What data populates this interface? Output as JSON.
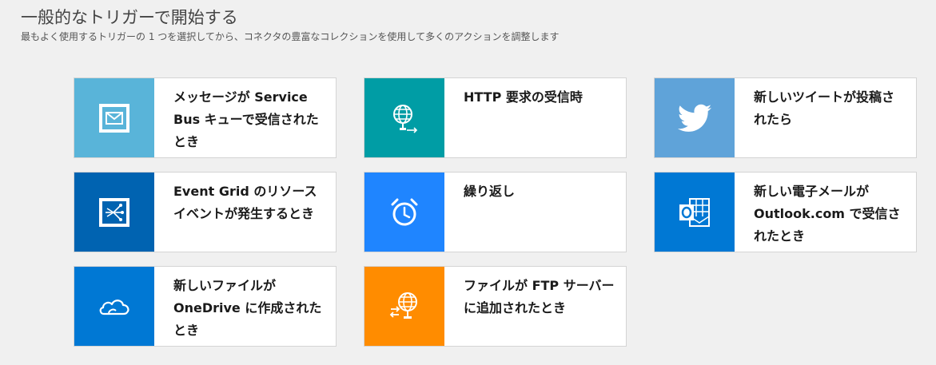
{
  "header": {
    "title": "一般的なトリガーで開始する",
    "subtitle": "最もよく使用するトリガーの 1 つを選択してから、コネクタの豊富なコレクションを使用して多くのアクションを調整します"
  },
  "cards": [
    {
      "label": "メッセージが Service Bus キューで受信されたとき",
      "icon": "service-bus-envelope-icon",
      "color": "#59b4d9"
    },
    {
      "label": "HTTP 要求の受信時",
      "icon": "http-globe-icon",
      "color": "#009da5"
    },
    {
      "label": "新しいツイートが投稿されたら",
      "icon": "twitter-bird-icon",
      "color": "#5fa3d9"
    },
    {
      "label": "Event Grid のリソース イベントが発生するとき",
      "icon": "event-grid-icon",
      "color": "#0063b1"
    },
    {
      "label": "繰り返し",
      "icon": "alarm-clock-icon",
      "color": "#1f85ff"
    },
    {
      "label": "新しい電子メールが Outlook.com で受信されたとき",
      "icon": "outlook-icon",
      "color": "#0078d4"
    },
    {
      "label": "新しいファイルが OneDrive に作成されたとき",
      "icon": "onedrive-cloud-icon",
      "color": "#0078d4"
    },
    {
      "label": "ファイルが FTP サーバーに追加されたとき",
      "icon": "ftp-globe-icon",
      "color": "#ff8c00"
    }
  ]
}
